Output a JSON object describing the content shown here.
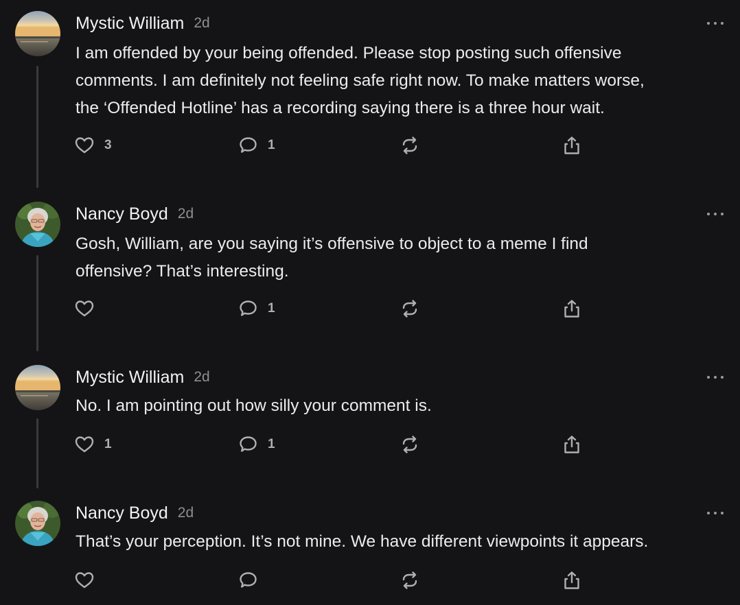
{
  "comments": [
    {
      "author": "Mystic William",
      "time": "2d",
      "avatar": "sunset-lake-avatar",
      "text_lines": [
        "I am offended by your being offended. Please stop posting such offensive",
        "comments. I am definitely not feeling safe right now. To make matters worse,",
        "the ‘Offended Hotline’ has a recording saying there is a three hour wait."
      ],
      "likes": "3",
      "replies": "1",
      "restacks": "",
      "share": ""
    },
    {
      "author": "Nancy Boyd",
      "time": "2d",
      "avatar": "woman-portrait-avatar",
      "text_lines": [
        "Gosh, William, are you saying it’s offensive to object to a meme I find",
        "offensive? That’s interesting."
      ],
      "likes": "",
      "replies": "1",
      "restacks": "",
      "share": ""
    },
    {
      "author": "Mystic William",
      "time": "2d",
      "avatar": "sunset-lake-avatar",
      "text_lines": [
        "No. I am pointing out how silly your comment is."
      ],
      "likes": "1",
      "replies": "1",
      "restacks": "",
      "share": ""
    },
    {
      "author": "Nancy Boyd",
      "time": "2d",
      "avatar": "woman-portrait-avatar",
      "text_lines": [
        "That’s your perception. It’s not mine. We have different viewpoints it appears."
      ],
      "likes": "",
      "replies": "",
      "restacks": "",
      "share": ""
    }
  ],
  "icons": {
    "like": "heart-icon",
    "reply": "speech-bubble-icon",
    "restack": "restack-arrows-icon",
    "share": "share-upload-icon",
    "more": "more-ellipsis-icon"
  },
  "colors": {
    "background": "#141416",
    "text": "#ececec",
    "muted": "#8e8e93",
    "thread_line": "#3a3a3e",
    "icon": "#b0b0b4"
  }
}
